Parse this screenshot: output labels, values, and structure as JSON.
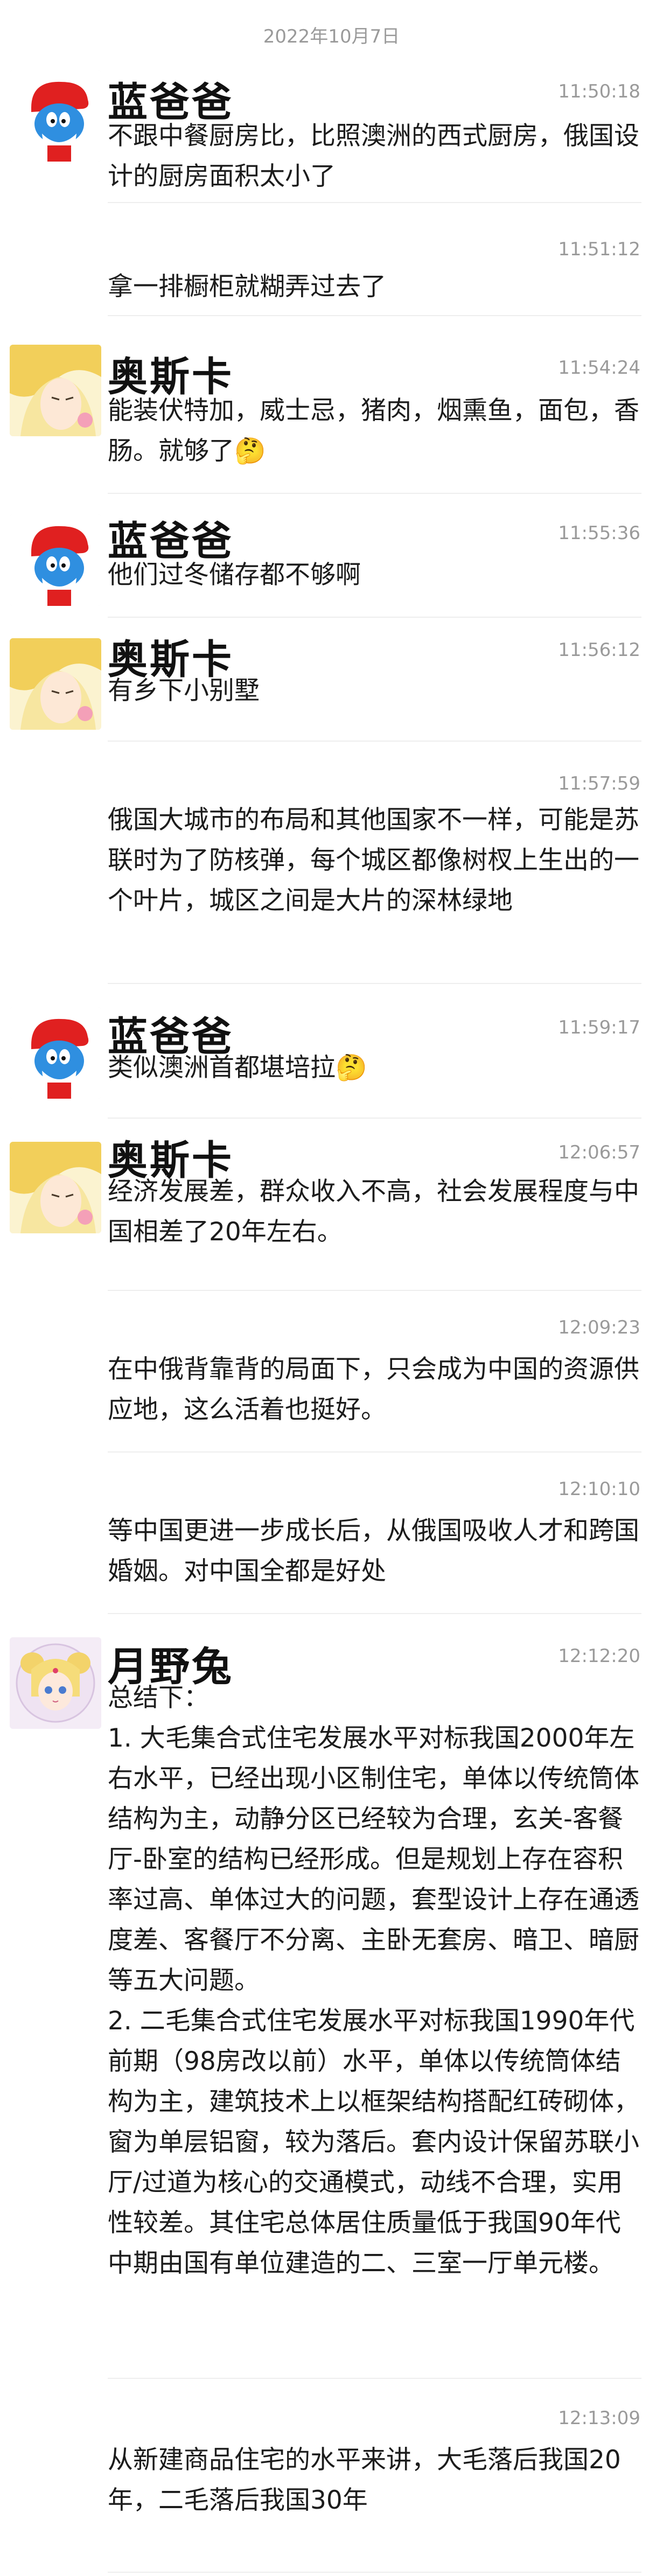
{
  "date_header": "2022年10月7日",
  "messages": [
    {
      "sender": "蓝爸爸",
      "time": "11:50:18",
      "text": "不跟中餐厨房比，比照澳洲的西式厨房，俄国设计的厨房面积太小了"
    },
    {
      "sender": "",
      "time": "11:51:12",
      "text": "拿一排橱柜就糊弄过去了"
    },
    {
      "sender": "奥斯卡",
      "time": "11:54:24",
      "text": "能装伏特加，威士忌，猪肉，烟熏鱼，面包，香肠。就够了🤔"
    },
    {
      "sender": "蓝爸爸",
      "time": "11:55:36",
      "text": "他们过冬储存都不够啊"
    },
    {
      "sender": "奥斯卡",
      "time": "11:56:12",
      "text": "有乡下小别墅"
    },
    {
      "sender": "",
      "time": "11:57:59",
      "text": "俄国大城市的布局和其他国家不一样，可能是苏联时为了防核弹，每个城区都像树杈上生出的一个叶片，城区之间是大片的深林绿地"
    },
    {
      "sender": "蓝爸爸",
      "time": "11:59:17",
      "text": "类似澳洲首都堪培拉🤔"
    },
    {
      "sender": "奥斯卡",
      "time": "12:06:57",
      "text": "经济发展差，群众收入不高，社会发展程度与中国相差了20年左右。"
    },
    {
      "sender": "",
      "time": "12:09:23",
      "text": "在中俄背靠背的局面下，只会成为中国的资源供应地，这么活着也挺好。"
    },
    {
      "sender": "",
      "time": "12:10:10",
      "text": "等中国更进一步成长后，从俄国吸收人才和跨国婚姻。对中国全都是好处"
    },
    {
      "sender": "月野兔",
      "time": "12:12:20",
      "text": "总结下：\n1. 大毛集合式住宅发展水平对标我国2000年左右水平，已经出现小区制住宅，单体以传统筒体结构为主，动静分区已经较为合理，玄关-客餐厅-卧室的结构已经形成。但是规划上存在容积率过高、单体过大的问题，套型设计上存在通透度差、客餐厅不分离、主卧无套房、暗卫、暗厨等五大问题。\n2. 二毛集合式住宅发展水平对标我国1990年代前期（98房改以前）水平，单体以传统筒体结构为主，建筑技术上以框架结构搭配红砖砌体，窗为单层铝窗，较为落后。套内设计保留苏联小厅/过道为核心的交通模式，动线不合理，实用性较差。其住宅总体居住质量低于我国90年代中期由国有单位建造的二、三室一厅单元楼。"
    },
    {
      "sender": "",
      "time": "12:13:09",
      "text": "从新建商品住宅的水平来讲，大毛落后我国20年，二毛落后我国30年"
    }
  ]
}
